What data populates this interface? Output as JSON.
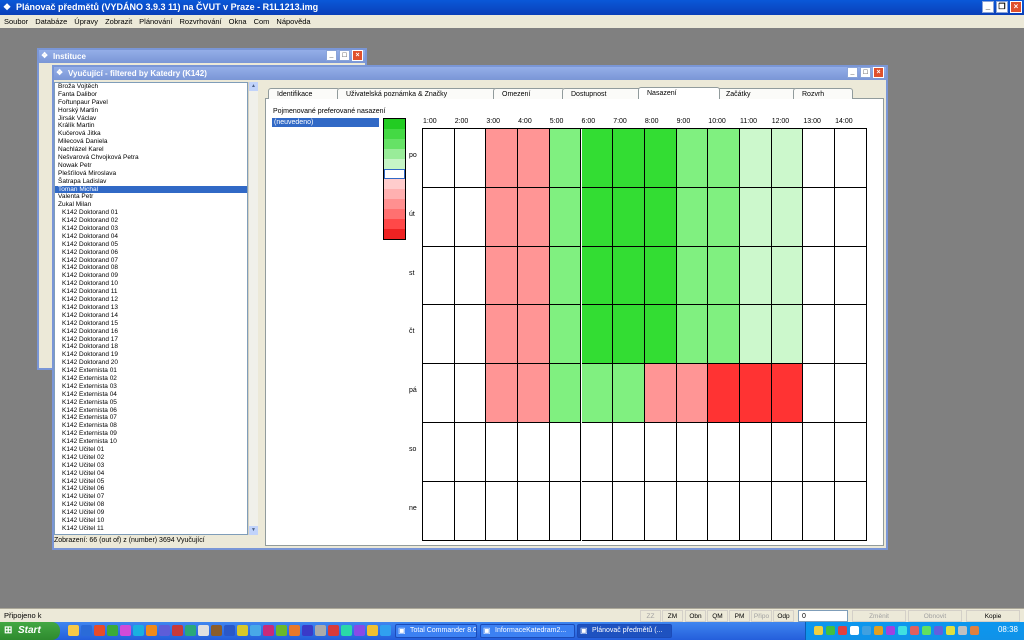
{
  "app": {
    "title": "Plánovač předmětů (VYDÁNO 3.9.3 11) na ČVUT v Praze - R1L1213.img",
    "menu": [
      "Soubor",
      "Databáze",
      "Úpravy",
      "Zobrazit",
      "Plánování",
      "Rozvrhování",
      "Okna",
      "Com",
      "Nápověda"
    ]
  },
  "instituce_window": {
    "title": "Instituce"
  },
  "main_window": {
    "title": "Vyučující - filtered by Katedry (K142)",
    "list_items": [
      "Broža Vojtěch",
      "Fanta Dalibor",
      "Fořtunpaur Pavel",
      "Horský Martin",
      "Jirsák Václav",
      "Králík Martin",
      "Kučerová Jitka",
      "Milecová Daniela",
      "Nachlázel Karel",
      "Nešvarová Chvojková Petra",
      "Nowak Petr",
      "Plešťilová Miroslava",
      "Šatrapa Ladislav",
      "Toman Michal",
      "Valenta Petr",
      "Zukal Milan",
      "K142 Doktorand 01",
      "K142 Doktorand 02",
      "K142 Doktorand 03",
      "K142 Doktorand 04",
      "K142 Doktorand 05",
      "K142 Doktorand 06",
      "K142 Doktorand 07",
      "K142 Doktorand 08",
      "K142 Doktorand 09",
      "K142 Doktorand 10",
      "K142 Doktorand 11",
      "K142 Doktorand 12",
      "K142 Doktorand 13",
      "K142 Doktorand 14",
      "K142 Doktorand 15",
      "K142 Doktorand 16",
      "K142 Doktorand 17",
      "K142 Doktorand 18",
      "K142 Doktorand 19",
      "K142 Doktorand 20",
      "K142 Externista 01",
      "K142 Externista 02",
      "K142 Externista 03",
      "K142 Externista 04",
      "K142 Externista 05",
      "K142 Externista 06",
      "K142 Externista 07",
      "K142 Externista 08",
      "K142 Externista 09",
      "K142 Externista 10",
      "K142 Učitel 01",
      "K142 Učitel 02",
      "K142 Učitel 03",
      "K142 Učitel 04",
      "K142 Učitel 05",
      "K142 Učitel 06",
      "K142 Učitel 07",
      "K142 Učitel 08",
      "K142 Učitel 09",
      "K142 Učitel 10",
      "K142 Učitel 11"
    ],
    "selected_item": "Toman Michal",
    "list_status": "Zobrazení: 66 (out of) z (number) 3694 Vyučující",
    "tabs": [
      "Identifikace",
      "Uživatelská poznámka & Značky",
      "Omezení",
      "Dostupnost",
      "Nasazení",
      "Začátky",
      "Rozvrh"
    ],
    "active_tab": "Nasazení",
    "pref_label": "Pojmenované preferované nasazení",
    "pref_item": "(neuvedeno)",
    "hours": [
      "1:00",
      "2:00",
      "3:00",
      "4:00",
      "5:00",
      "6:00",
      "7:00",
      "8:00",
      "9:00",
      "10:00",
      "11:00",
      "12:00",
      "13:00",
      "14:00"
    ],
    "days": [
      "po",
      "út",
      "st",
      "čt",
      "pá",
      "so",
      "ne"
    ],
    "palette_colors": [
      "#22cc22",
      "#44d944",
      "#66e266",
      "#99ec99",
      "#c6f5c6",
      "#ffffff",
      "#ffcccc",
      "#ffb0b0",
      "#ff9090",
      "#ff7070",
      "#ff4848",
      "#ee2222"
    ],
    "grid_colors": [
      [
        "#ffffff",
        "#ffffff",
        "#ff9595",
        "#ff9595",
        "#80f080",
        "#33dd33",
        "#33dd33",
        "#33dd33",
        "#80f080",
        "#80f080",
        "#ccf8cc",
        "#ccf8cc",
        "#ffffff",
        "#ffffff"
      ],
      [
        "#ffffff",
        "#ffffff",
        "#ff9595",
        "#ff9595",
        "#80f080",
        "#33dd33",
        "#33dd33",
        "#33dd33",
        "#80f080",
        "#80f080",
        "#ccf8cc",
        "#ccf8cc",
        "#ffffff",
        "#ffffff"
      ],
      [
        "#ffffff",
        "#ffffff",
        "#ff9595",
        "#ff9595",
        "#80f080",
        "#33dd33",
        "#33dd33",
        "#33dd33",
        "#80f080",
        "#80f080",
        "#ccf8cc",
        "#ccf8cc",
        "#ffffff",
        "#ffffff"
      ],
      [
        "#ffffff",
        "#ffffff",
        "#ff9595",
        "#ff9595",
        "#80f080",
        "#33dd33",
        "#33dd33",
        "#33dd33",
        "#80f080",
        "#80f080",
        "#ccf8cc",
        "#ccf8cc",
        "#ffffff",
        "#ffffff"
      ],
      [
        "#ffffff",
        "#ffffff",
        "#ff9595",
        "#ff9595",
        "#80f080",
        "#80f080",
        "#80f080",
        "#ff9595",
        "#ff9595",
        "#ff3333",
        "#ff3333",
        "#ff3333",
        "#ffffff",
        "#ffffff"
      ],
      [
        "#ffffff",
        "#ffffff",
        "#ffffff",
        "#ffffff",
        "#ffffff",
        "#ffffff",
        "#ffffff",
        "#ffffff",
        "#ffffff",
        "#ffffff",
        "#ffffff",
        "#ffffff",
        "#ffffff",
        "#ffffff"
      ],
      [
        "#ffffff",
        "#ffffff",
        "#ffffff",
        "#ffffff",
        "#ffffff",
        "#ffffff",
        "#ffffff",
        "#ffffff",
        "#ffffff",
        "#ffffff",
        "#ffffff",
        "#ffffff",
        "#ffffff",
        "#ffffff"
      ]
    ]
  },
  "statusbar": {
    "text": "Připojeno k",
    "buttons": [
      "ZZ",
      "ZM",
      "Obn",
      "QM",
      "PM",
      "Připo",
      "Odp"
    ],
    "disabled_buttons": [
      "ZZ",
      "Připo"
    ],
    "field_value": "0",
    "right_buttons": [
      "Změnit",
      "Obnovit",
      "Kopie"
    ],
    "disabled_right": [
      "Změnit",
      "Obnovit"
    ]
  },
  "taskbar": {
    "start_label": "Start",
    "tasks": [
      "Total Commander 8.0...",
      "InformaceKatedram2...",
      "Plánovač předmětů (..."
    ],
    "active_task": 2,
    "clock": "08:38"
  }
}
